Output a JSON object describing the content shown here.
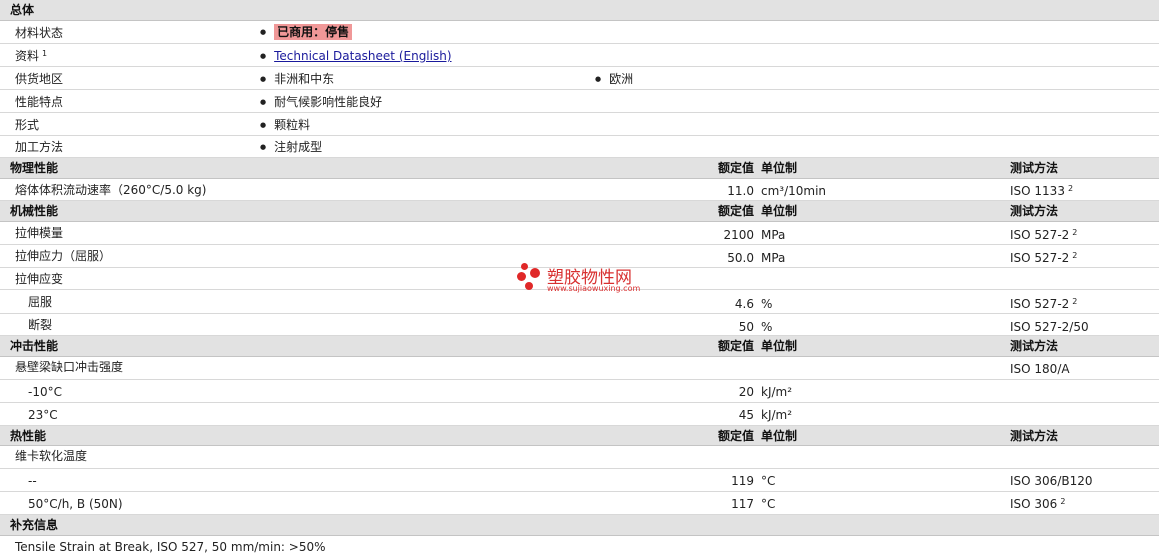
{
  "general": {
    "title": "总体",
    "material_status": {
      "label": "材料状态",
      "value": "已商用：停售"
    },
    "documents": {
      "label": "资料",
      "sup": "1",
      "link": "Technical Datasheet (English)"
    },
    "availability": {
      "label": "供货地区",
      "values": [
        "非洲和中东",
        "欧洲"
      ]
    },
    "features": {
      "label": "性能特点",
      "value": "耐气候影响性能良好"
    },
    "forms": {
      "label": "形式",
      "value": "颗粒料"
    },
    "processing": {
      "label": "加工方法",
      "value": "注射成型"
    }
  },
  "headers": {
    "nominal": "额定值",
    "unit": "单位制",
    "test": "测试方法"
  },
  "physical": {
    "title": "物理性能",
    "rows": [
      {
        "label": "熔体体积流动速率（260°C/5.0 kg)",
        "value": "11.0",
        "unit": "cm³/10min",
        "test": "ISO 1133",
        "sup": "2"
      }
    ]
  },
  "mechanical": {
    "title": "机械性能",
    "modulus": {
      "label": "拉伸模量",
      "value": "2100",
      "unit": "MPa",
      "test": "ISO 527-2",
      "sup": "2"
    },
    "stress": {
      "label": "拉伸应力（屈服）",
      "value": "50.0",
      "unit": "MPa",
      "test": "ISO 527-2",
      "sup": "2"
    },
    "strain": {
      "label": "拉伸应变"
    },
    "yield": {
      "label": "屈服",
      "value": "4.6",
      "unit": "%",
      "test": "ISO 527-2",
      "sup": "2"
    },
    "break": {
      "label": "断裂",
      "value": "50",
      "unit": "%",
      "test": "ISO 527-2/50"
    }
  },
  "impact": {
    "title": "冲击性能",
    "charpy": {
      "label": "悬壁梁缺口冲击强度",
      "test": "ISO 180/A"
    },
    "minus10": {
      "label": "-10°C",
      "value": "20",
      "unit": "kJ/m²"
    },
    "plus23": {
      "label": "23°C",
      "value": "45",
      "unit": "kJ/m²"
    }
  },
  "thermal": {
    "title": "热性能",
    "vicat": {
      "label": "维卡软化温度"
    },
    "dash": {
      "label": "--",
      "value": "119",
      "unit": "°C",
      "test": "ISO 306/B120"
    },
    "rate": {
      "label": "50°C/h, B (50N)",
      "value": "117",
      "unit": "°C",
      "test": "ISO 306",
      "sup": "2"
    }
  },
  "supplement": {
    "title": "补充信息",
    "note": "Tensile Strain at Break, ISO 527, 50 mm/min: >50%"
  },
  "watermark": {
    "text": "塑胶物性网",
    "url": "www.sujiaowuxing.com"
  }
}
